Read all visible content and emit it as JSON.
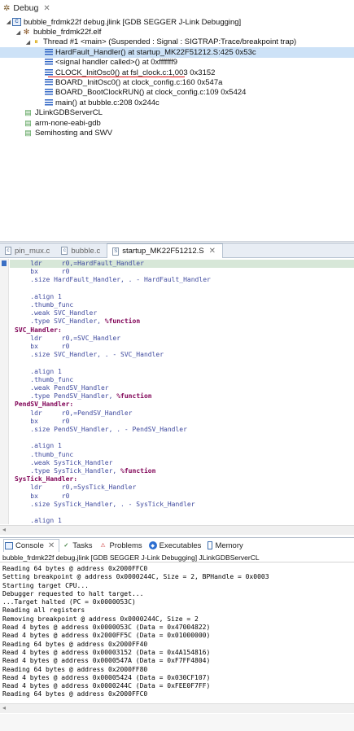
{
  "debug": {
    "tab_label": "Debug",
    "tree": [
      {
        "label": "bubble_frdmk22f debug.jlink [GDB SEGGER J-Link Debugging]"
      },
      {
        "label": "bubble_frdmk22f.elf"
      },
      {
        "label": "Thread #1 <main> (Suspended : Signal : SIGTRAP:Trace/breakpoint trap)"
      },
      {
        "label": "HardFault_Handler() at startup_MK22F51212.S:425 0x53c"
      },
      {
        "label": "<signal handler called>() at 0xfffffff9"
      },
      {
        "label": "CLOCK_InitOsc0() at fsl_clock.c:1,003 0x3152"
      },
      {
        "label": "BOARD_InitOsc0() at clock_config.c:160 0x547a"
      },
      {
        "label": "BOARD_BootClockRUN() at clock_config.c:109 0x5424"
      },
      {
        "label": "main() at bubble.c:208 0x244c"
      },
      {
        "label": "JLinkGDBServerCL"
      },
      {
        "label": "arm-none-eabi-gdb"
      },
      {
        "label": "Semihosting and SWV"
      }
    ]
  },
  "editor": {
    "tabs": [
      {
        "label": "pin_mux.c"
      },
      {
        "label": "bubble.c"
      },
      {
        "label": "startup_MK22F51212.S"
      }
    ],
    "lines": [
      "    ldr     r0,=HardFault_Handler",
      "    bx      r0",
      "    .size HardFault_Handler, . - HardFault_Handler",
      "",
      "    .align 1",
      "    .thumb_func",
      "    .weak SVC_Handler",
      "    .type SVC_Handler, %function",
      "SVC_Handler:",
      "    ldr     r0,=SVC_Handler",
      "    bx      r0",
      "    .size SVC_Handler, . - SVC_Handler",
      "",
      "    .align 1",
      "    .thumb_func",
      "    .weak PendSV_Handler",
      "    .type PendSV_Handler, %function",
      "PendSV_Handler:",
      "    ldr     r0,=PendSV_Handler",
      "    bx      r0",
      "    .size PendSV_Handler, . - PendSV_Handler",
      "",
      "    .align 1",
      "    .thumb_func",
      "    .weak SysTick_Handler",
      "    .type SysTick_Handler, %function",
      "SysTick_Handler:",
      "    ldr     r0,=SysTick_Handler",
      "    bx      r0",
      "    .size SysTick_Handler, . - SysTick_Handler",
      "",
      "    .align 1"
    ]
  },
  "console": {
    "tabs": [
      {
        "label": "Console"
      },
      {
        "label": "Tasks"
      },
      {
        "label": "Problems"
      },
      {
        "label": "Executables"
      },
      {
        "label": "Memory"
      }
    ],
    "title": "bubble_frdmk22f debug.jlink [GDB SEGGER J-Link Debugging] JLinkGDBServerCL",
    "lines": [
      "Reading 64 bytes @ address 0x2000FFC0",
      "Setting breakpoint @ address 0x0000244C, Size = 2, BPHandle = 0x0003",
      "Starting target CPU...",
      "Debugger requested to halt target...",
      "...Target halted (PC = 0x0000053C)",
      "Reading all registers",
      "Removing breakpoint @ address 0x0000244C, Size = 2",
      "Read 4 bytes @ address 0x0000053C (Data = 0x47004822)",
      "Read 4 bytes @ address 0x2000FF5C (Data = 0x01000000)",
      "Reading 64 bytes @ address 0x2000FF40",
      "Read 4 bytes @ address 0x00003152 (Data = 0x4A154816)",
      "Read 4 bytes @ address 0x0000547A (Data = 0xF7FF4804)",
      "Reading 64 bytes @ address 0x2000FF80",
      "Read 4 bytes @ address 0x00005424 (Data = 0x030CF107)",
      "Read 4 bytes @ address 0x0000244C (Data = 0xFEE0F7FF)",
      "Reading 64 bytes @ address 0x2000FFC0"
    ]
  }
}
